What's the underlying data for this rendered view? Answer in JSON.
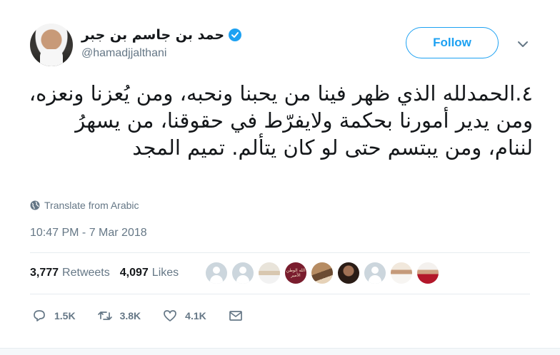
{
  "author": {
    "display_name": "حمد بن جاسم بن جبر",
    "handle": "@hamadjjalthani",
    "verified": true
  },
  "follow_button": {
    "label": "Follow"
  },
  "tweet": {
    "text": "٤.الحمدلله الذي ظهر فينا من يحبنا ونحبه، ومن يُعزنا ونعزه، ومن يدير أمورنا بحكمة ولايفرّط في حقوقنا، من يسهرُ لننام، ومن يبتسم حتى لو كان يتألم. تميم المجد",
    "translate_label": "Translate from Arabic",
    "timestamp": "10:47 PM - 7 Mar 2018"
  },
  "stats": {
    "retweets_count": "3,777",
    "retweets_label": "Retweets",
    "likes_count": "4,097",
    "likes_label": "Likes"
  },
  "likers_caption": "الله الوطن الأمير",
  "actions": {
    "replies": "1.5K",
    "retweets": "3.8K",
    "likes": "4.1K"
  },
  "colors": {
    "accent": "#1da1f2",
    "muted": "#657786",
    "text": "#14171a"
  }
}
